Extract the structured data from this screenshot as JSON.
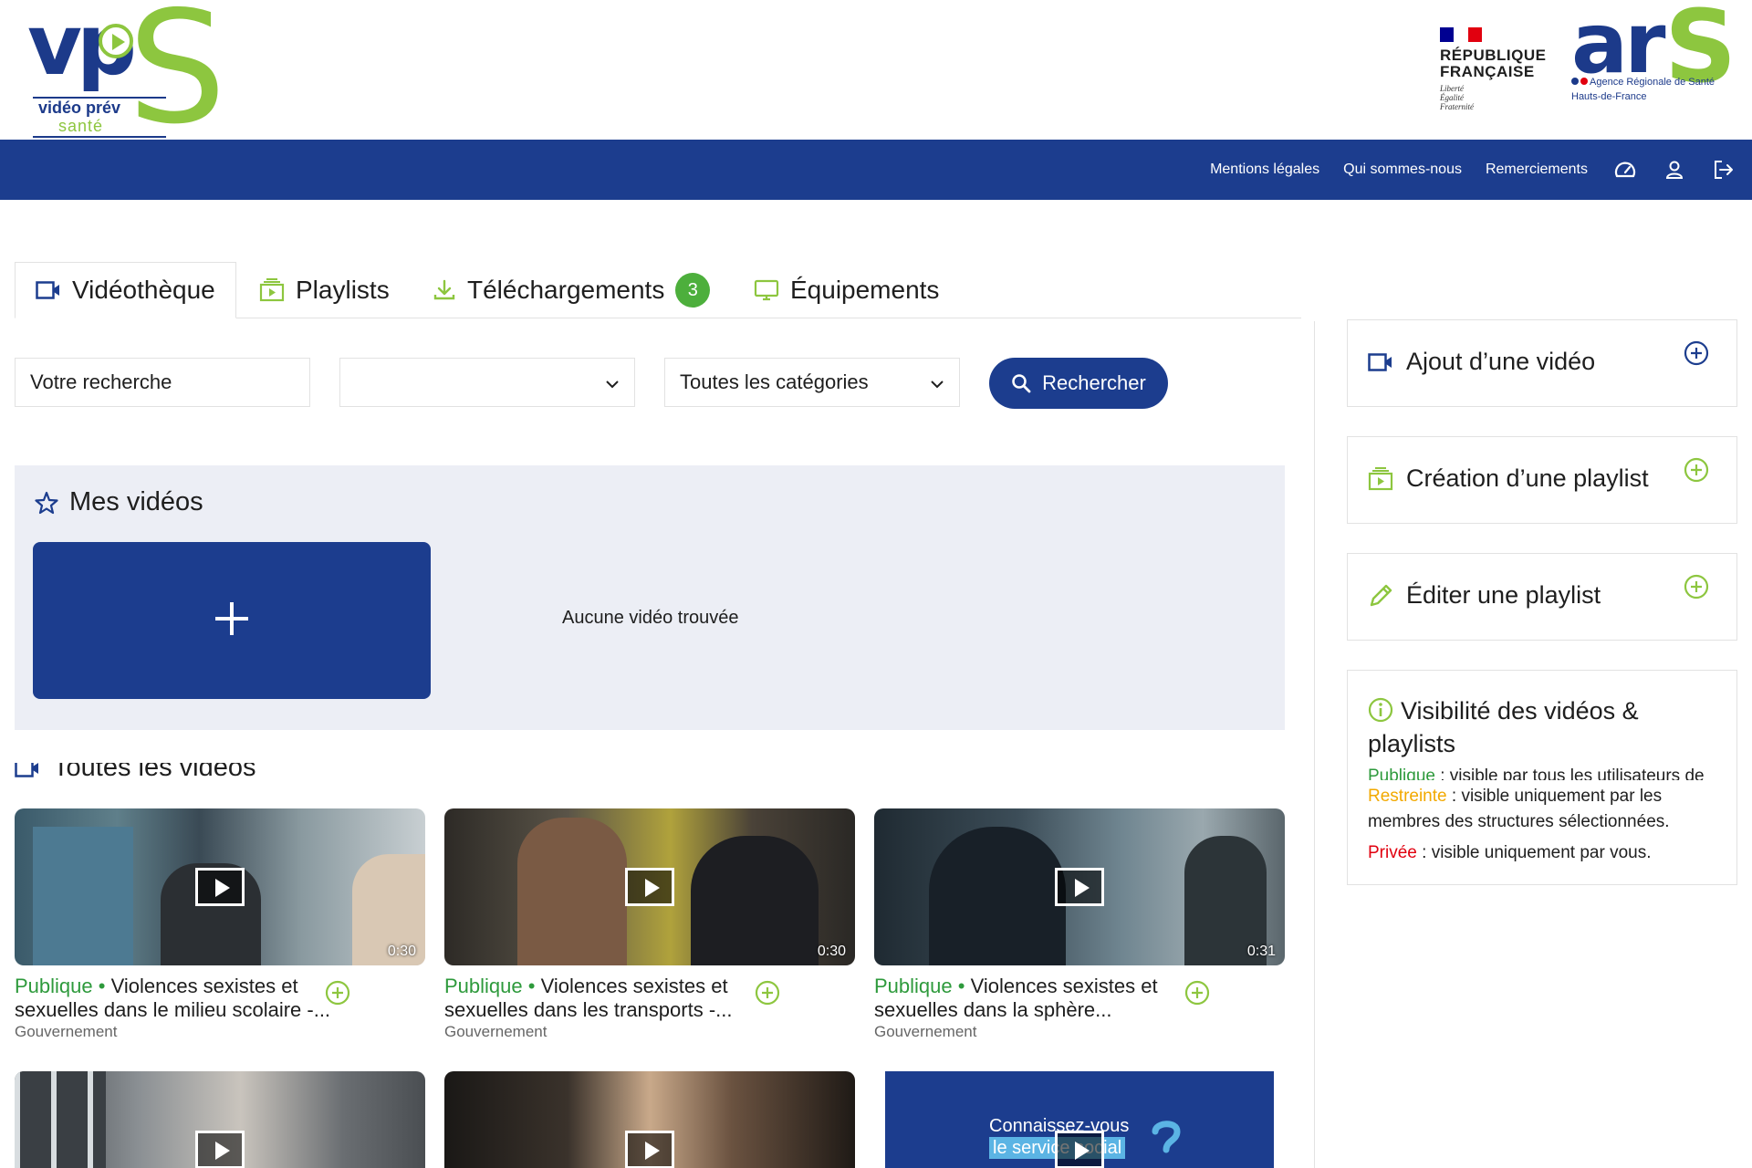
{
  "header": {
    "vps_logo": {
      "mark": "vp",
      "mark_s": "S",
      "line1": "vidéo prév",
      "line2": "santé"
    },
    "rf_logo": {
      "line1": "RÉPUBLIQUE",
      "line2": "FRANÇAISE",
      "motto1": "Liberté",
      "motto2": "Égalité",
      "motto3": "Fraternité"
    },
    "ars_logo": {
      "mark": "ar",
      "mark_s": "S",
      "sub1": "Agence Régionale de Santé",
      "sub2": "Hauts-de-France"
    },
    "colors": {
      "brand_blue": "#1c3d8e",
      "brand_green": "#8dc63f"
    }
  },
  "nav": {
    "links": [
      "Mentions légales",
      "Qui sommes-nous",
      "Remerciements"
    ],
    "icons": [
      "dashboard-icon",
      "user-icon",
      "logout-icon"
    ]
  },
  "tabs": [
    {
      "label": "Vidéothèque",
      "icon": "video-camera-icon",
      "active": true
    },
    {
      "label": "Playlists",
      "icon": "playlist-icon"
    },
    {
      "label": "Téléchargements",
      "icon": "download-icon",
      "badge": "3"
    },
    {
      "label": "Équipements",
      "icon": "monitor-icon"
    }
  ],
  "search": {
    "placeholder": "Votre recherche",
    "select1_value": "",
    "select2_value": "Toutes les catégories",
    "button_label": "Rechercher"
  },
  "mes_videos": {
    "title": "Mes vidéos",
    "empty_text": "Aucune vidéo trouvée"
  },
  "toutes_videos": {
    "title": "Toutes les vidéos"
  },
  "videos": [
    {
      "visibility": "Publique",
      "title_l1": "Violences sexistes et",
      "title_l2": "sexuelles dans le milieu scolaire -...",
      "author": "Gouvernement",
      "duration": "0:30"
    },
    {
      "visibility": "Publique",
      "title_l1": "Violences sexistes et",
      "title_l2": "sexuelles dans les transports -...",
      "author": "Gouvernement",
      "duration": "0:30"
    },
    {
      "visibility": "Publique",
      "title_l1": "Violences sexistes et",
      "title_l2": "sexuelles dans la sphère...",
      "author": "Gouvernement",
      "duration": "0:31"
    },
    {
      "thumb_text_l1": "Connaissez-vous",
      "thumb_text_l2": "le service social"
    }
  ],
  "sidebar": {
    "actions": [
      {
        "label": "Ajout d’une vidéo",
        "icon": "video-camera-icon"
      },
      {
        "label": "Création d’une playlist",
        "icon": "playlist-icon"
      },
      {
        "label": "Éditer une playlist",
        "icon": "pencil-icon"
      }
    ],
    "info": {
      "title": "Visibilité des vidéos & playlists",
      "publique_label": "Publique",
      "publique_text": " : visible par tous les utilisateurs de",
      "restreinte_label": "Restreinte",
      "restreinte_text": " : visible uniquement par les membres des structures sélectionnées.",
      "privee_label": "Privée",
      "privee_text": " : visible uniquement par vous."
    }
  }
}
